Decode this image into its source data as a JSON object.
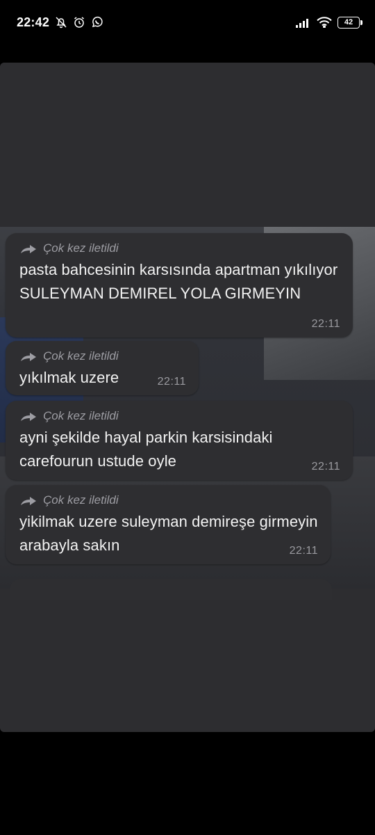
{
  "status_bar": {
    "time": "22:42",
    "left_icons": [
      "muted-bell-icon",
      "alarm-icon",
      "whatsapp-icon"
    ],
    "battery": "42"
  },
  "messages": [
    {
      "forwarded_label": "Çok kez iletildi",
      "text": "pasta bahcesinin karsısında apartman yıkılıyor SULEYMAN DEMIREL YOLA GIRMEYIN",
      "time": "22:11"
    },
    {
      "forwarded_label": "Çok kez iletildi",
      "text": "yıkılmak uzere",
      "time": "22:11"
    },
    {
      "forwarded_label": "Çok kez iletildi",
      "text": "ayni şekilde hayal parkin karsisindaki carefourun ustude oyle",
      "time": "22:11"
    },
    {
      "forwarded_label": "Çok kez iletildi",
      "text": "yikilmak uzere suleyman demireşe girmeyin arabayla sakın",
      "time": "22:11"
    }
  ],
  "colors": {
    "bubble": "#2e2e31",
    "meta_text": "#9b9ba0",
    "background": "#000000"
  }
}
